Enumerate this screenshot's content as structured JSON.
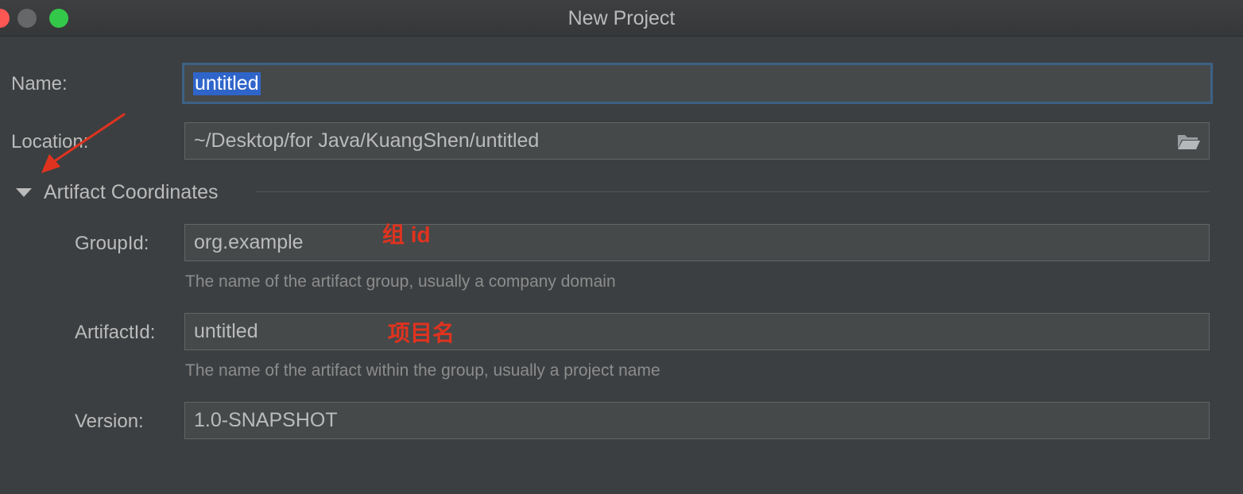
{
  "window": {
    "title": "New Project"
  },
  "form": {
    "name_label": "Name:",
    "name_value": "untitled",
    "location_label": "Location:",
    "location_value": "~/Desktop/for Java/KuangShen/untitled",
    "section_title": "Artifact Coordinates",
    "groupid_label": "GroupId:",
    "groupid_value": "org.example",
    "groupid_hint": "The name of the artifact group, usually a company domain",
    "artifactid_label": "ArtifactId:",
    "artifactid_value": "untitled",
    "artifactid_hint": "The name of the artifact within the group, usually a project name",
    "version_label": "Version:",
    "version_value": "1.0-SNAPSHOT"
  },
  "annotations": {
    "groupid_note": "组 id",
    "artifactid_note": "项目名"
  },
  "colors": {
    "background": "#3c3f41",
    "field_bg": "#45494a",
    "focus_border": "#3d6185",
    "selection": "#2f65ca",
    "annotation": "#e0331f"
  },
  "icons": {
    "location_browse": "folder-icon",
    "section_toggle": "triangle-down-icon"
  }
}
